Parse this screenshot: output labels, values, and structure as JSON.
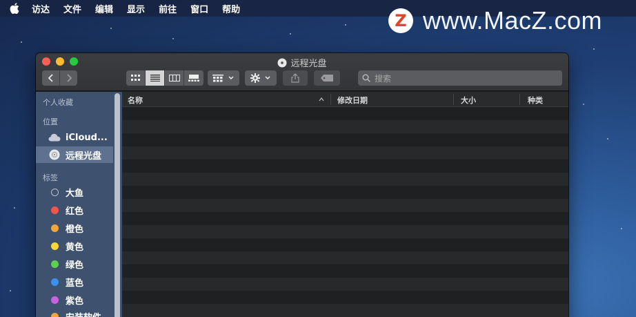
{
  "menubar": {
    "items": [
      {
        "label": "访达"
      },
      {
        "label": "文件"
      },
      {
        "label": "编辑"
      },
      {
        "label": "显示"
      },
      {
        "label": "前往"
      },
      {
        "label": "窗口"
      },
      {
        "label": "帮助"
      }
    ]
  },
  "watermark": {
    "logo_letter": "Z",
    "text": "www.MacZ.com"
  },
  "window": {
    "title": "远程光盘",
    "search_placeholder": "搜索",
    "columns": [
      "名称",
      "修改日期",
      "大小",
      "种类"
    ]
  },
  "sidebar": {
    "favorites_header": "个人收藏",
    "locations_header": "位置",
    "locations": [
      {
        "label": "iCloud...",
        "icon": "cloud-icon"
      },
      {
        "label": "远程光盘",
        "icon": "disc-icon",
        "selected": true
      }
    ],
    "tags_header": "标签",
    "tags": [
      {
        "label": "大鱼",
        "color": "transparent"
      },
      {
        "label": "红色",
        "color": "#f0574c"
      },
      {
        "label": "橙色",
        "color": "#f2a63a"
      },
      {
        "label": "黄色",
        "color": "#f6d83a"
      },
      {
        "label": "绿色",
        "color": "#5fd14f"
      },
      {
        "label": "蓝色",
        "color": "#3d8ff0"
      },
      {
        "label": "紫色",
        "color": "#c864e0"
      },
      {
        "label": "安装软件",
        "color": "#f2a63a"
      }
    ]
  }
}
